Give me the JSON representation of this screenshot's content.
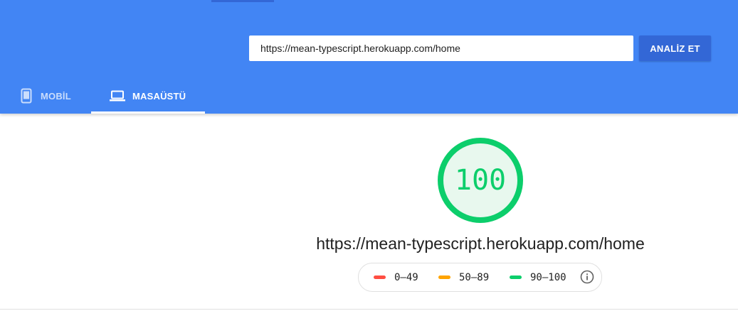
{
  "header": {
    "url_input": {
      "value": "https://mean-typescript.herokuapp.com/home",
      "placeholder": ""
    },
    "analyze_label": "ANALİZ ET",
    "tabs": [
      {
        "label": "MOBİL",
        "icon": "smartphone-icon",
        "active": false
      },
      {
        "label": "MASAÜSTÜ",
        "icon": "laptop-icon",
        "active": true
      }
    ]
  },
  "main": {
    "score": "100",
    "score_fraction": 1.0,
    "url": "https://mean-typescript.herokuapp.com/home",
    "legend": [
      {
        "label": "0–49",
        "color": "#ff4e42"
      },
      {
        "label": "50–89",
        "color": "#ffa400"
      },
      {
        "label": "90–100",
        "color": "#0cce6b"
      }
    ],
    "info_icon": "info-icon"
  },
  "colors": {
    "header_bg": "#4285f4",
    "button_bg": "#3367d6",
    "pass": "#0cce6b",
    "pass_fill": "#e8f8ee"
  }
}
